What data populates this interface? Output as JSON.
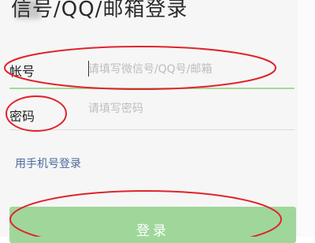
{
  "header": {
    "title": "信号/QQ/邮箱登录"
  },
  "form": {
    "account_label": "帐号",
    "account_placeholder": "请填写微信号/QQ号/邮箱",
    "password_label": "密码",
    "password_placeholder": "请填写密码"
  },
  "links": {
    "phone_login": "用手机号登录"
  },
  "actions": {
    "login_label": "登录"
  },
  "colors": {
    "annotation": "#e0242a",
    "accent_green": "#9fd79a",
    "link": "#4a6a9a"
  }
}
